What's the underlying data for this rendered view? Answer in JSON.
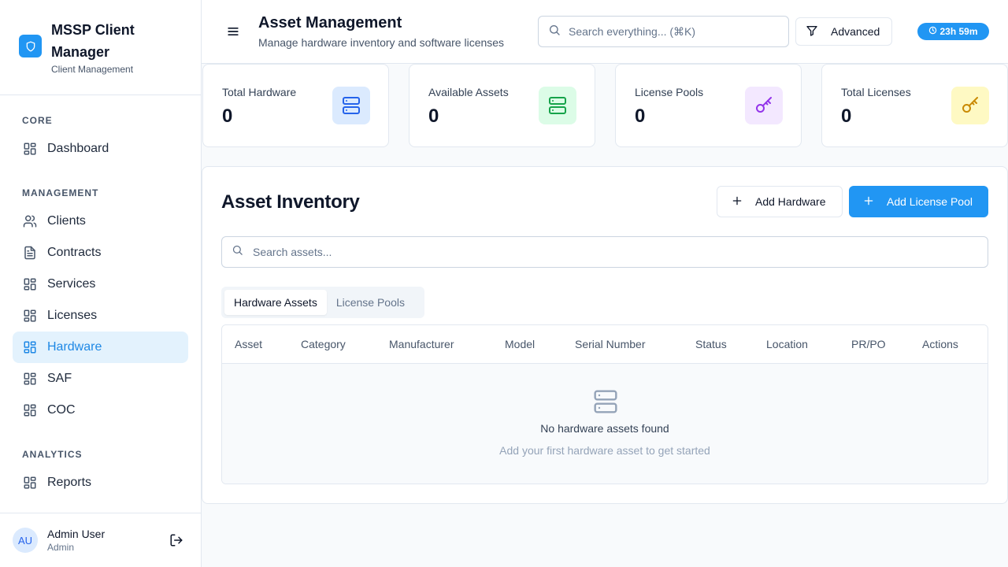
{
  "app": {
    "name": "MSSP Client Manager",
    "subtitle": "Client Management"
  },
  "sidebar": {
    "sections": [
      {
        "title": "CORE"
      },
      {
        "title": "MANAGEMENT"
      },
      {
        "title": "ANALYTICS"
      }
    ],
    "items": [
      {
        "label": "Dashboard",
        "icon": "grid-icon"
      },
      {
        "label": "Clients",
        "icon": "users-icon"
      },
      {
        "label": "Contracts",
        "icon": "file-text-icon"
      },
      {
        "label": "Services",
        "icon": "grid-icon"
      },
      {
        "label": "Licenses",
        "icon": "grid-icon"
      },
      {
        "label": "Hardware",
        "icon": "grid-icon",
        "active": true
      },
      {
        "label": "SAF",
        "icon": "grid-icon"
      },
      {
        "label": "COC",
        "icon": "grid-icon"
      },
      {
        "label": "Reports",
        "icon": "grid-icon"
      }
    ]
  },
  "user": {
    "initials": "AU",
    "name": "Admin User",
    "role": "Admin"
  },
  "header": {
    "title": "Asset Management",
    "subtitle": "Manage hardware inventory and software licenses",
    "search_placeholder": "Search everything... (⌘K)",
    "advanced_label": "Advanced",
    "timer": "23h 59m"
  },
  "stats": [
    {
      "label": "Total Hardware",
      "value": "0",
      "icon": "server-icon",
      "color": "#2563eb",
      "bg": "#dbeafe"
    },
    {
      "label": "Available Assets",
      "value": "0",
      "icon": "server-icon",
      "color": "#16a34a",
      "bg": "#dcfce7"
    },
    {
      "label": "License Pools",
      "value": "0",
      "icon": "key-icon",
      "color": "#9333ea",
      "bg": "#f3e8ff"
    },
    {
      "label": "Total Licenses",
      "value": "0",
      "icon": "key-icon",
      "color": "#ca8a04",
      "bg": "#fef9c3"
    }
  ],
  "inventory": {
    "title": "Asset Inventory",
    "add_hardware_label": "Add Hardware",
    "add_license_pool_label": "Add License Pool",
    "search_placeholder": "Search assets...",
    "tabs": [
      {
        "label": "Hardware Assets",
        "active": true
      },
      {
        "label": "License Pools",
        "active": false
      }
    ],
    "columns": [
      "Asset",
      "Category",
      "Manufacturer",
      "Model",
      "Serial Number",
      "Status",
      "Location",
      "PR/PO",
      "Actions"
    ],
    "empty_title": "No hardware assets found",
    "empty_subtitle": "Add your first hardware asset to get started"
  },
  "colors": {
    "accent": "#2196f3",
    "active_nav_bg": "#e3f2fd"
  }
}
